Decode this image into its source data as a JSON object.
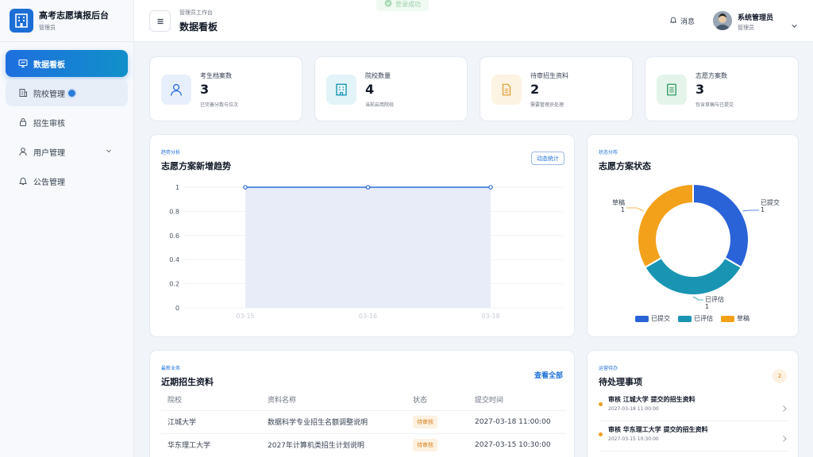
{
  "brand": {
    "title": "高考志愿填报后台",
    "subtitle": "管理员"
  },
  "sidebar": {
    "items": [
      {
        "label": "数据看板",
        "icon": "dashboard-icon"
      },
      {
        "label": "院校管理",
        "icon": "building-icon"
      },
      {
        "label": "招生审核",
        "icon": "lock-icon"
      },
      {
        "label": "用户管理",
        "icon": "user-icon"
      },
      {
        "label": "公告管理",
        "icon": "bell-icon"
      }
    ]
  },
  "header": {
    "sub": "管理员工作台",
    "title": "数据看板",
    "toast": "登录成功",
    "messages": "消息",
    "user_name": "系统管理员",
    "user_role": "管理员"
  },
  "stats": [
    {
      "label": "考生档案数",
      "value": "3",
      "note": "已完善分数与位次",
      "icon": "user-icon",
      "color": "#2f6fd9",
      "bg": "#e8effc"
    },
    {
      "label": "院校数量",
      "value": "4",
      "note": "当前启用院校",
      "icon": "building-icon",
      "color": "#1593b5",
      "bg": "#e3f4f8"
    },
    {
      "label": "待审招生资料",
      "value": "2",
      "note": "需要管理员处理",
      "icon": "document-icon",
      "color": "#e0a03a",
      "bg": "#fdf3e2"
    },
    {
      "label": "志愿方案数",
      "value": "3",
      "note": "包含草稿与已提交",
      "icon": "list-icon",
      "color": "#2e9a62",
      "bg": "#e4f4ea"
    }
  ],
  "trend": {
    "sub": "趋势分析",
    "title": "志愿方案新增趋势",
    "button": "动态统计"
  },
  "status": {
    "sub": "状态分布",
    "title": "志愿方案状态"
  },
  "chart_data": [
    {
      "type": "area",
      "title": "志愿方案新增趋势",
      "x": [
        "03-15",
        "03-16",
        "03-18"
      ],
      "series": [
        {
          "values": [
            1,
            1,
            1
          ]
        }
      ],
      "ylim": [
        0,
        1
      ],
      "yticks": [
        "1",
        "0.8",
        "0.6",
        "0.4",
        "0.2",
        "0"
      ],
      "grid": true,
      "color": "#2f6fd9"
    },
    {
      "type": "pie",
      "title": "志愿方案状态",
      "categories": [
        "已提交",
        "已评估",
        "草稿"
      ],
      "values": [
        1,
        1,
        1
      ],
      "colors": [
        "#2a62d8",
        "#1995b3",
        "#f3a11b"
      ],
      "legend": "bottom"
    }
  ],
  "recent": {
    "sub": "最新业务",
    "title": "近期招生资料",
    "view_all": "查看全部",
    "columns": [
      "院校",
      "资料名称",
      "状态",
      "提交时间"
    ],
    "rows": [
      {
        "school": "江城大学",
        "name": "数据科学专业招生名额调整说明",
        "status": "待审核",
        "time": "2027-03-18 11:00:00"
      },
      {
        "school": "华东理工大学",
        "name": "2027年计算机类招生计划说明",
        "status": "待审核",
        "time": "2027-03-15 10:30:00"
      }
    ]
  },
  "todos": {
    "sub": "运营待办",
    "title": "待处理事项",
    "count": "2",
    "items": [
      {
        "title": "审核 江城大学 提交的招生资料",
        "date": "2027-03-18 11:00:00"
      },
      {
        "title": "审核 华东理工大学 提交的招生资料",
        "date": "2027-03-15 10:30:00"
      }
    ]
  }
}
